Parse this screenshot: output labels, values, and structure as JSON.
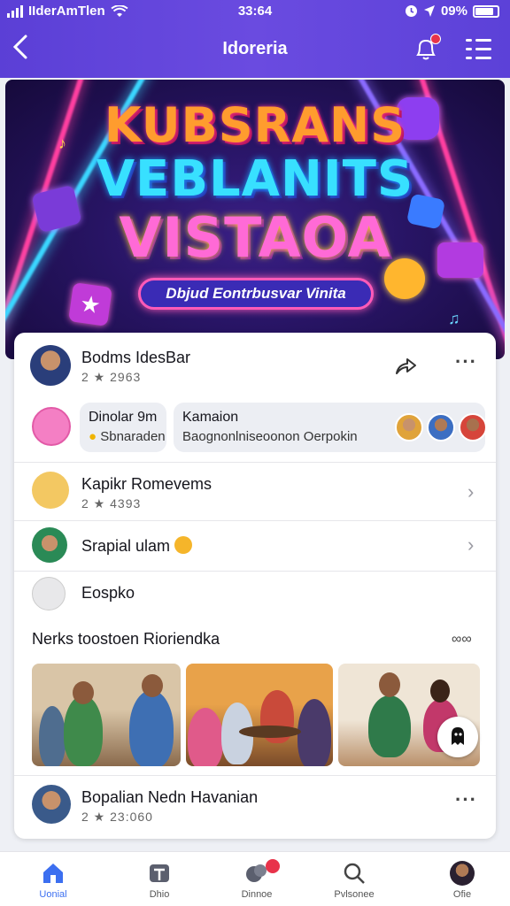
{
  "status_bar": {
    "carrier": "IIderAmTlen",
    "time": "33:64",
    "battery": "09%"
  },
  "header": {
    "title": "Idoreria"
  },
  "banner": {
    "line1": "KUBSRANS",
    "line2": "VEBLANITS",
    "line3": "VISTAOA",
    "pill": "Dbjud Eontrbusvar Vinita"
  },
  "feed": {
    "post1": {
      "name": "Bodms IdesBar",
      "meta": "2 ★ 2963"
    },
    "chips": {
      "chip1_title": "Dinolar 9m",
      "chip1_sub": "Sbnaraden",
      "chip2_title": "Kamaion",
      "chip2_sub": "Baognonlniseoonon Oerpokin"
    },
    "item1": {
      "name": "Kapikr Romevems",
      "meta": "2 ★ 4393"
    },
    "item2": {
      "name": "Srapial ulam"
    },
    "item3": {
      "name": "Eospko"
    },
    "section_title": "Nerks toostoen Rioriendka",
    "section_more": "∞∞",
    "post2": {
      "name": "Bopalian Nedn Havanian",
      "meta": "2 ★ 23:060"
    }
  },
  "tabs": [
    {
      "label": "Uonial",
      "icon": "home-icon"
    },
    {
      "label": "Dhio",
      "icon": "photo-icon"
    },
    {
      "label": "Dinnoe",
      "icon": "chat-icon"
    },
    {
      "label": "Pvlsonee",
      "icon": "search-icon"
    },
    {
      "label": "Ofie",
      "icon": "profile-icon"
    }
  ],
  "colors": {
    "header": "#5b3fd6",
    "accent": "#4a6cf7",
    "badge": "#e8334a"
  }
}
